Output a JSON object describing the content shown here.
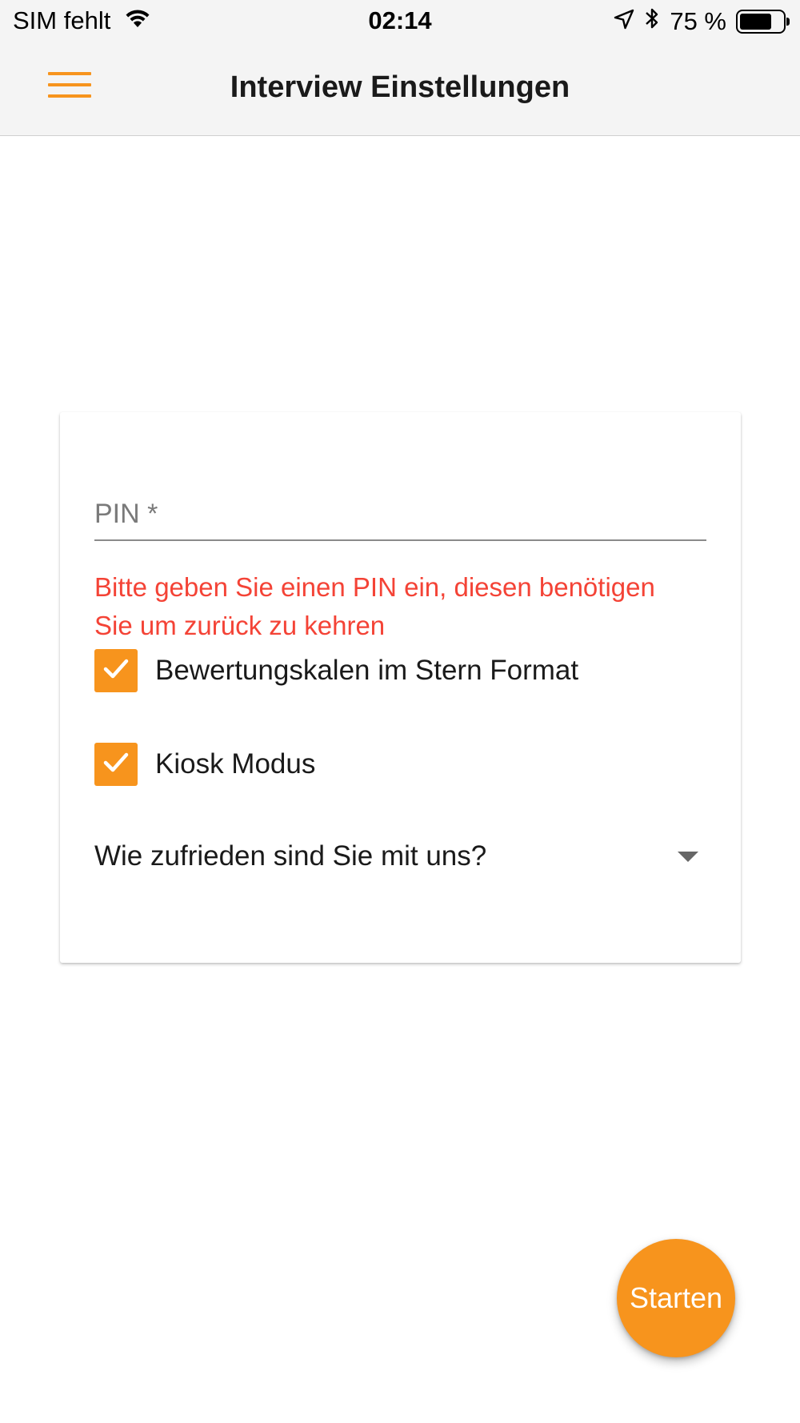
{
  "status_bar": {
    "carrier": "SIM fehlt",
    "time": "02:14",
    "battery": "75 %",
    "battery_level": 0.75,
    "icons": [
      "wifi-icon",
      "location-arrow-icon",
      "bluetooth-icon",
      "battery-icon"
    ]
  },
  "app_bar": {
    "title": "Interview Einstellungen",
    "menu_icon": "hamburger-menu-icon"
  },
  "form": {
    "pin_placeholder": "PIN *",
    "pin_value": "",
    "pin_error": "Bitte geben Sie einen PIN ein, diesen benötigen Sie um zurück zu kehren",
    "checkboxes": [
      {
        "label": "Bewertungskalen im Stern Format",
        "checked": true
      },
      {
        "label": "Kiosk Modus",
        "checked": true
      }
    ],
    "survey_select": {
      "selected": "Wie zufrieden sind Sie mit uns?"
    }
  },
  "fab": {
    "label": "Starten"
  },
  "colors": {
    "accent": "#f7941d",
    "error": "#f44336",
    "app_bar_bg": "#f4f4f4"
  }
}
